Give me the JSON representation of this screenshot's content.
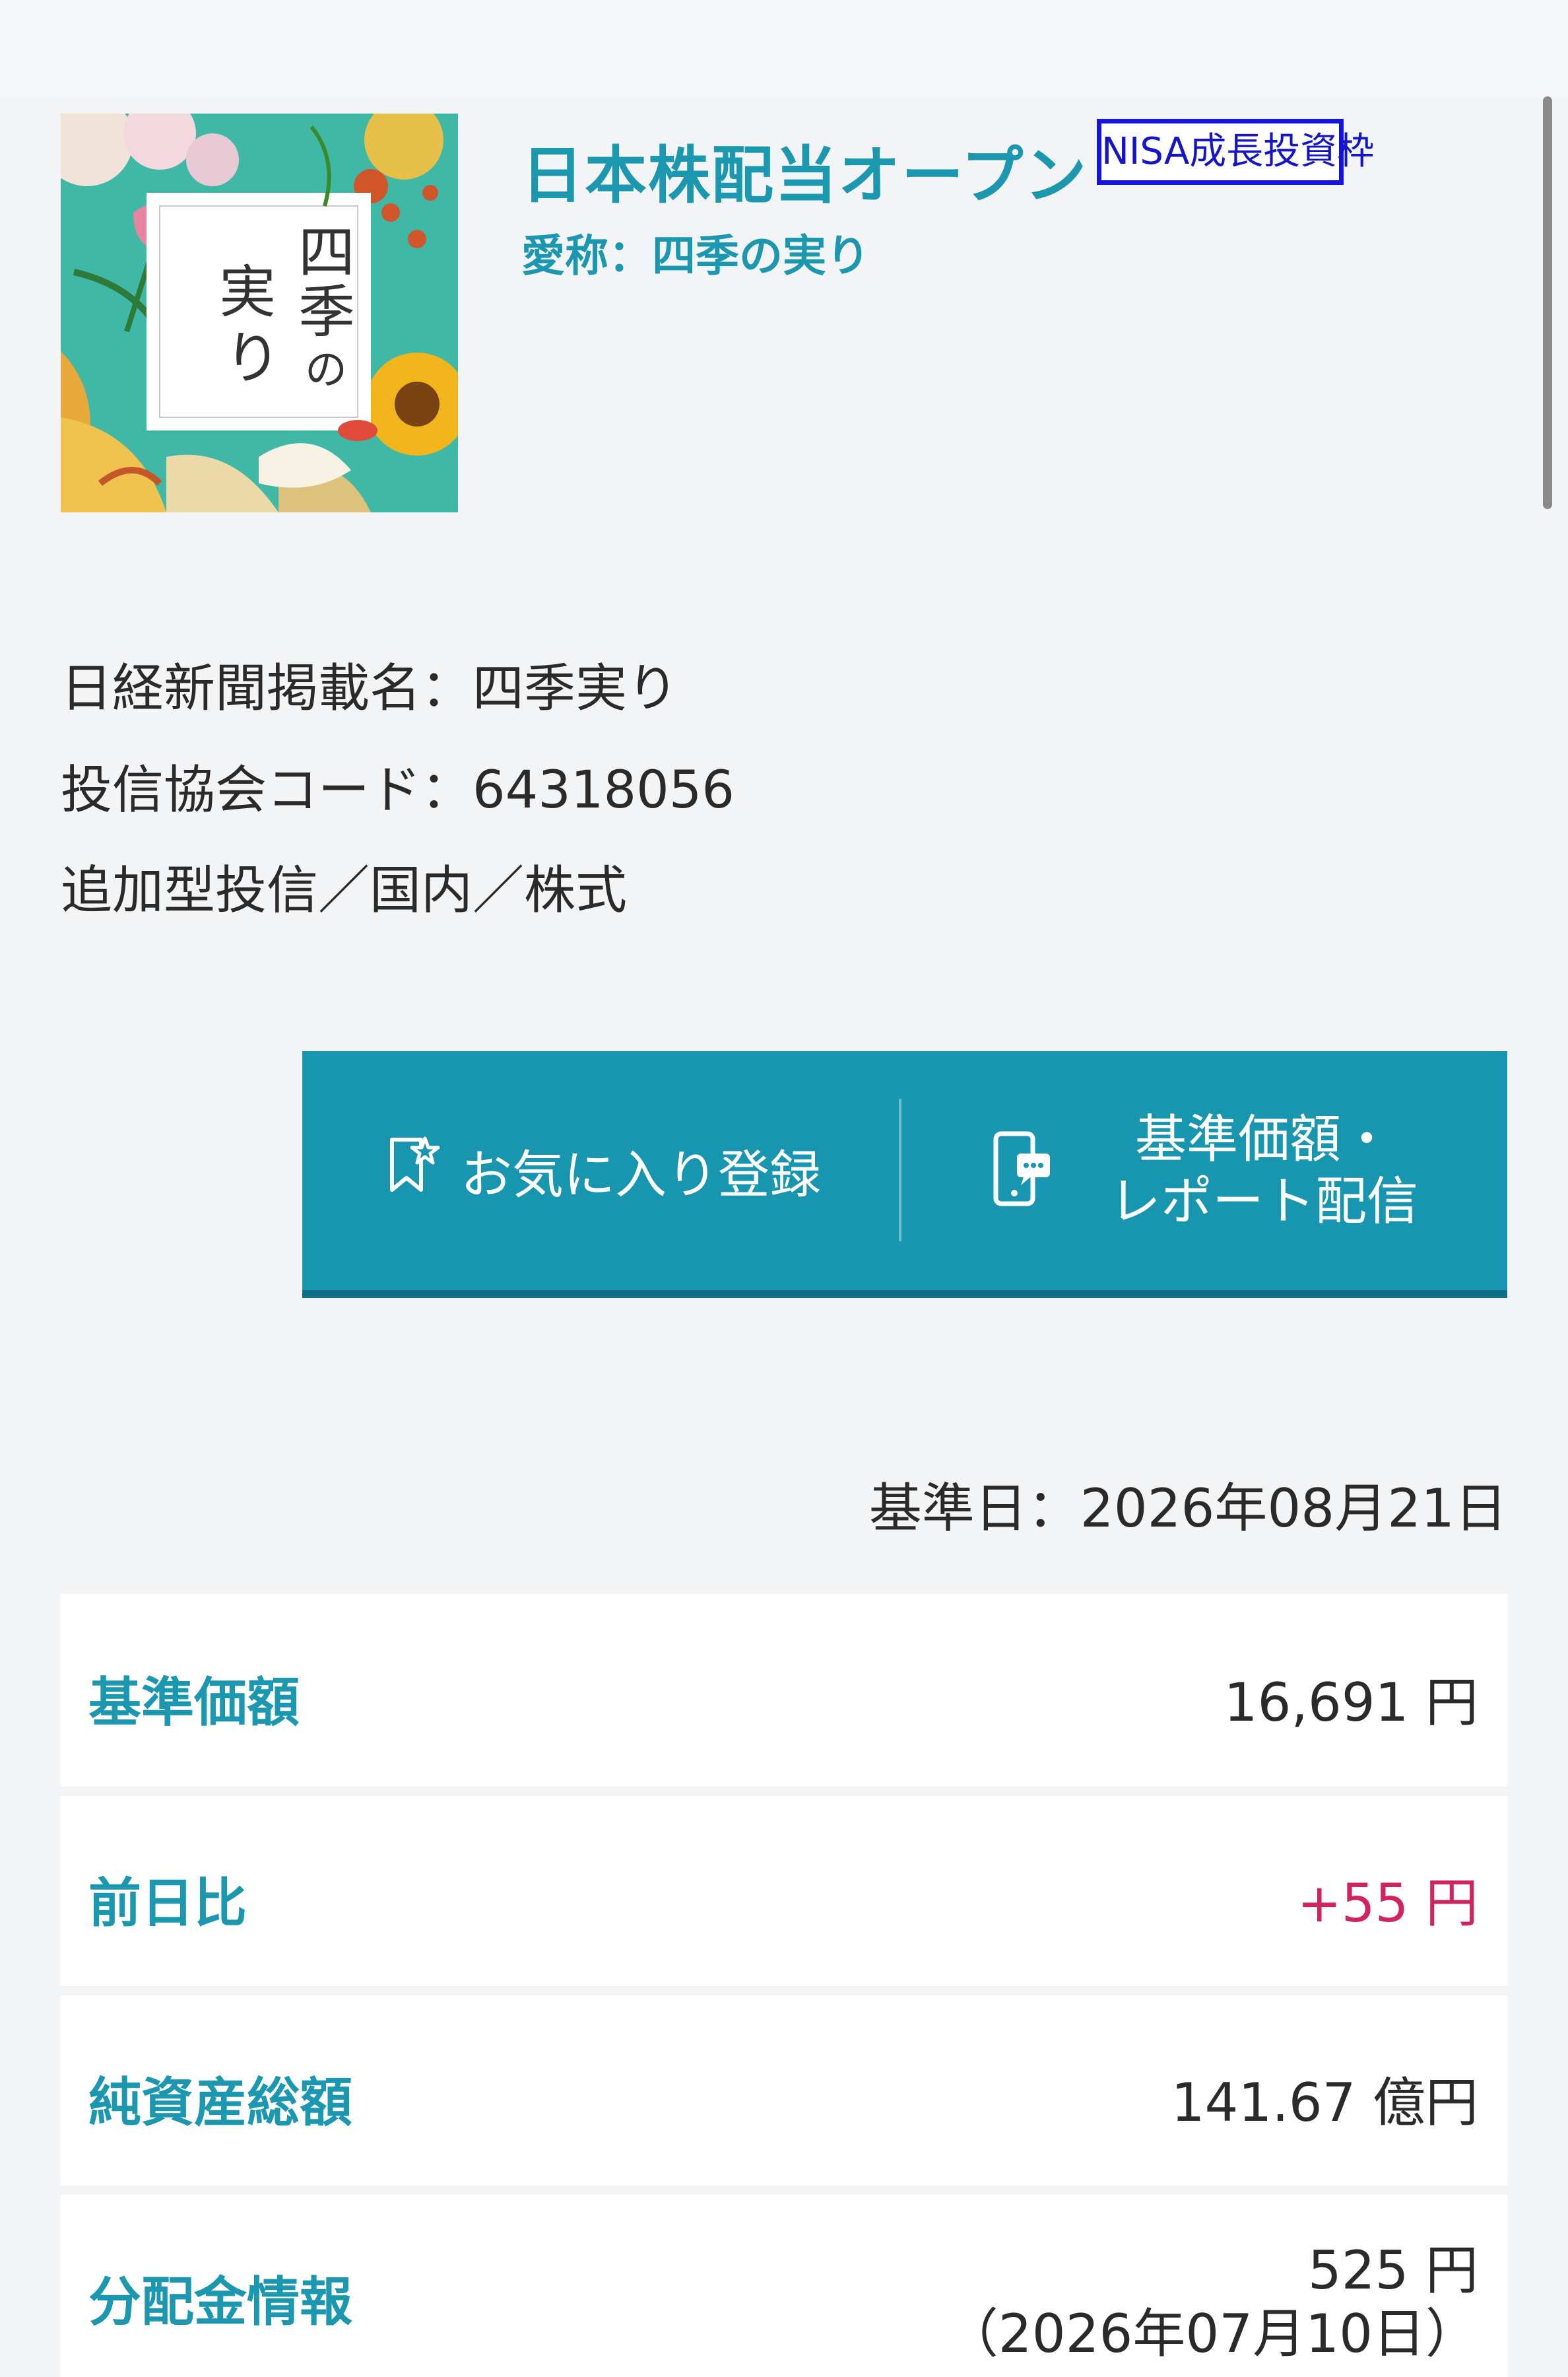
{
  "fund": {
    "title": "日本株配当オープン",
    "nisa_badge": "NISA成長投資枠",
    "nickname": "愛称：四季の実り",
    "image_text": "四季の実り",
    "nikkei_name": "日経新聞掲載名：四季実り",
    "association_code": "投信協会コード：64318056",
    "category": "追加型投信／国内／株式"
  },
  "actions": {
    "favorite_label": "お気に入り登録",
    "alert_label_line1": "基準価額・",
    "alert_label_line2": "レポート配信"
  },
  "base_date": "基準日：2026年08月21日",
  "rows": [
    {
      "label": "基準価額",
      "value": "16,691 円"
    },
    {
      "label": "前日比",
      "value": "+55 円",
      "trend": "up"
    },
    {
      "label": "純資産総額",
      "value": "141.67 億円"
    },
    {
      "label": "分配金情報",
      "value": "525 円",
      "sub": "（2026年07月10日）"
    }
  ],
  "colors": {
    "accent": "#1b97b0",
    "button": "#1896b0",
    "positive": "#d0245f",
    "badge_border": "#1414e0"
  }
}
